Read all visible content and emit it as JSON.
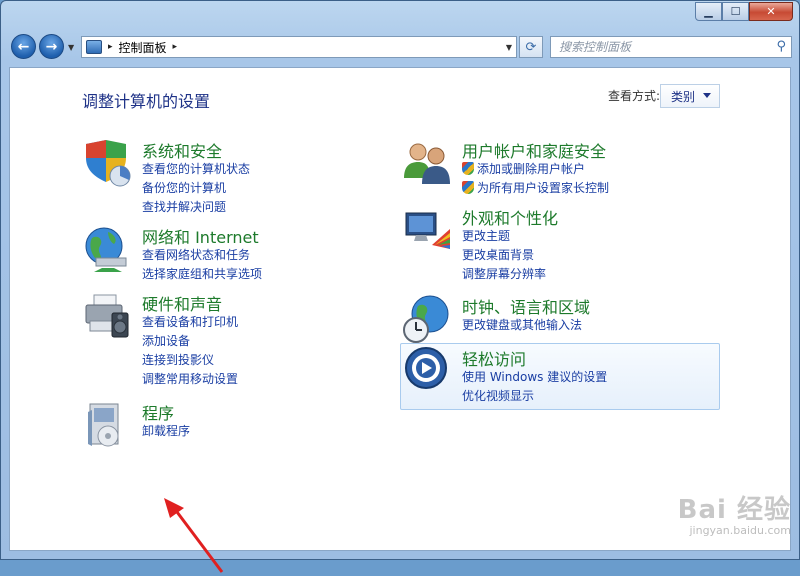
{
  "window": {
    "controls": {
      "minimize": "▁",
      "maximize": "☐",
      "close": "✕"
    }
  },
  "nav": {
    "back": "←",
    "forward": "→",
    "address": {
      "breadcrumb": "控制面板",
      "sep": "▸"
    },
    "search": {
      "placeholder": "搜索控制面板"
    }
  },
  "main": {
    "title": "调整计算机的设置",
    "view_by_label": "查看方式:",
    "view_by_value": "类别"
  },
  "categories": [
    {
      "title": "系统和安全",
      "icon": "system-security-icon",
      "links": [
        "查看您的计算机状态",
        "备份您的计算机",
        "查找并解决问题"
      ]
    },
    {
      "title": "网络和 Internet",
      "icon": "network-icon",
      "links": [
        "查看网络状态和任务",
        "选择家庭组和共享选项"
      ]
    },
    {
      "title": "硬件和声音",
      "icon": "hardware-sound-icon",
      "links": [
        "查看设备和打印机",
        "添加设备",
        "连接到投影仪",
        "调整常用移动设置"
      ]
    },
    {
      "title": "程序",
      "icon": "programs-icon",
      "links": [
        "卸载程序"
      ]
    },
    {
      "title": "用户帐户和家庭安全",
      "icon": "user-accounts-icon",
      "links": [
        "添加或删除用户帐户",
        "为所有用户设置家长控制"
      ]
    },
    {
      "title": "外观和个性化",
      "icon": "appearance-icon",
      "links": [
        "更改主题",
        "更改桌面背景",
        "调整屏幕分辨率"
      ]
    },
    {
      "title": "时钟、语言和区域",
      "icon": "clock-region-icon",
      "links": [
        "更改键盘或其他输入法"
      ]
    },
    {
      "title": "轻松访问",
      "icon": "ease-of-access-icon",
      "links": [
        "使用 Windows 建议的设置",
        "优化视频显示"
      ]
    }
  ],
  "watermark": {
    "brand": "Bai 经验",
    "url": "jingyan.baidu.com"
  },
  "colors": {
    "title_green": "#1d7a2b",
    "link_blue": "#1a3ea3",
    "heading_blue": "#1e3287",
    "arrow_red": "#e02020"
  }
}
